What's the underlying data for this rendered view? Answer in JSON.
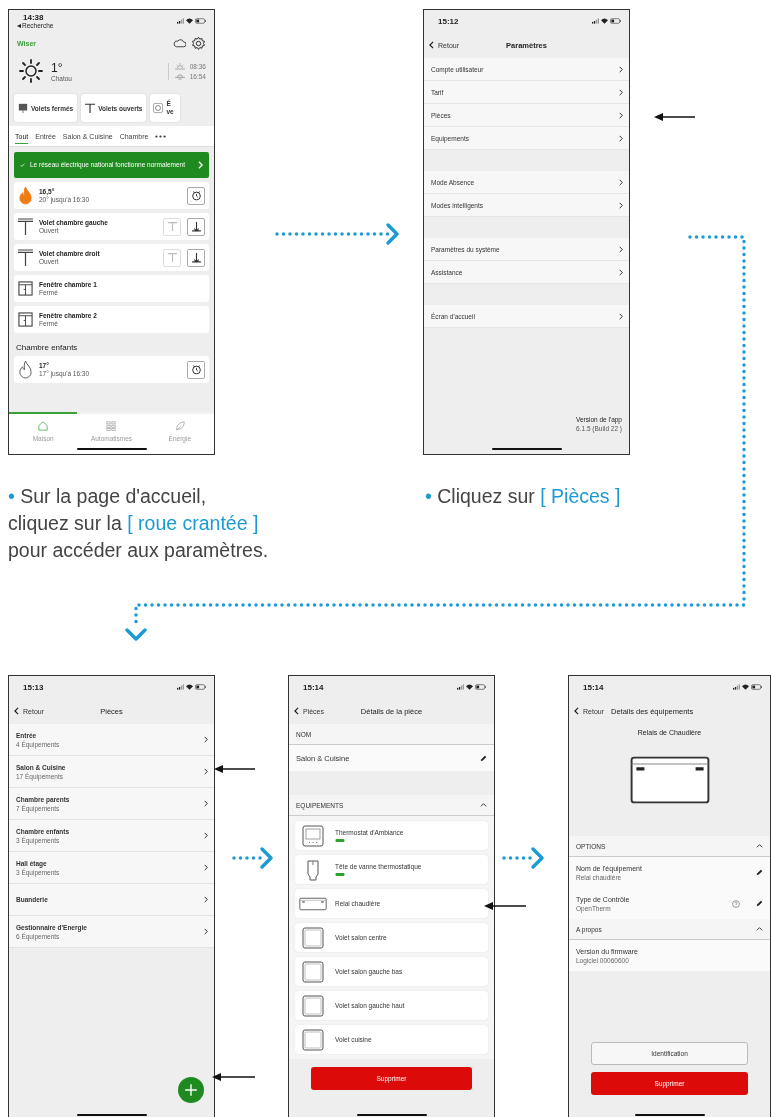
{
  "screens": [
    {
      "kind": "home",
      "time": "14:38",
      "back": "Recherche",
      "logo": "Wiser",
      "weather": {
        "temp": "1°",
        "city": "Chatou",
        "sunrise": "08:36",
        "sunset": "16:54"
      },
      "shortcuts": [
        {
          "kind": "closed",
          "label": "Volets fermés"
        },
        {
          "kind": "open",
          "label": "Volets ouverts"
        },
        {
          "kind": "timer",
          "label": "É ve"
        }
      ],
      "tabs": [
        {
          "label": "Tout",
          "selected": true
        },
        {
          "label": "Entrée",
          "selected": false
        },
        {
          "label": "Salon & Cuisine",
          "selected": false
        },
        {
          "label": "Chambre",
          "selected": false
        }
      ],
      "banner": "Le réseau électrique national fonctionne normalement",
      "items": [
        {
          "kind": "heating",
          "active": true,
          "title": "16,5°",
          "subtitle": "20° jusqu'à 16:30"
        },
        {
          "kind": "shutter",
          "title": "Volet chambre gauche",
          "subtitle": "Ouvert"
        },
        {
          "kind": "shutter",
          "title": "Volet chambre droit",
          "subtitle": "Ouvert"
        },
        {
          "kind": "window",
          "title": "Fenêtre chambre 1",
          "subtitle": "Fermé"
        },
        {
          "kind": "window",
          "title": "Fenêtre chambre 2",
          "subtitle": "Fermé"
        },
        {
          "kind": "section",
          "title": "Chambre enfants"
        },
        {
          "kind": "heating",
          "active": false,
          "title": "17°",
          "subtitle": "17° jusqu'à 16:30"
        }
      ],
      "nav": [
        {
          "kind": "home",
          "label": "Maison",
          "selected": true
        },
        {
          "kind": "automations",
          "label": "Automatismes",
          "selected": false
        },
        {
          "kind": "energy",
          "label": "Énergie",
          "selected": false
        }
      ]
    },
    {
      "kind": "settings",
      "time": "15:12",
      "back": "Retour",
      "title": "Paramètres",
      "groups": [
        [
          "Compte utilisateur",
          "Tarif",
          "Pièces",
          "Equipements"
        ],
        [
          "Mode Absence",
          "Modes intelligents"
        ],
        [
          "Paramètres du système",
          "Assistance"
        ],
        [
          "Écran d'accueil"
        ]
      ],
      "version_label": "Version de l'app",
      "version": "6.1.5 (Build 22 )"
    },
    {
      "kind": "rooms",
      "time": "15:13",
      "back": "Retour",
      "title": "Pièces",
      "rooms": [
        {
          "name": "Entrée",
          "count": "4 Équipements"
        },
        {
          "name": "Salon & Cuisine",
          "count": "17 Équipements"
        },
        {
          "name": "Chambre parents",
          "count": "7 Équipements"
        },
        {
          "name": "Chambre enfants",
          "count": "3 Équipements"
        },
        {
          "name": "Hall étage",
          "count": "3 Équipements"
        },
        {
          "name": "Buanderie"
        },
        {
          "name": "Gestionnaire d'Energie",
          "count": "6 Équipements"
        }
      ]
    },
    {
      "kind": "room_details",
      "time": "15:14",
      "back": "Pièces",
      "title": "Détails de la pièce",
      "name_header": "NOM",
      "name": "Salon & Cuisine",
      "devices_header": "EQUIPEMENTS",
      "devices_expanded": true,
      "devices": [
        {
          "kind": "thermostat",
          "name": "Thermostat d'Ambiance"
        },
        {
          "kind": "valve",
          "name": "Tête de vanne thermostatique"
        },
        {
          "kind": "relay",
          "name": "Relai chaudière"
        },
        {
          "kind": "shutter",
          "name": "Volet salon centre"
        },
        {
          "kind": "shutter",
          "name": "Volet salon gauche bas"
        },
        {
          "kind": "shutter",
          "name": "Volet salon gauche haut"
        },
        {
          "kind": "shutter",
          "name": "Volet cuisine"
        }
      ],
      "delete": "Supprimer"
    },
    {
      "kind": "device_details",
      "time": "15:14",
      "back": "Retour",
      "title": "Details des équipements",
      "device": "Relais de Chaudière",
      "sections": [
        {
          "title": "OPTIONS",
          "expanded": true,
          "rows": [
            {
              "label": "Nom de l'équipement",
              "value": "Relai chaudière",
              "help": false,
              "editable": true
            },
            {
              "label": "Type de Contrôle",
              "value": "OpenTherm",
              "help": true,
              "editable": true
            }
          ]
        },
        {
          "title": "A propos",
          "expanded": true,
          "rows": [
            {
              "label": "Version du firmware",
              "value": "Logiciel 00060600",
              "help": false,
              "editable": false
            }
          ]
        }
      ],
      "buttons": [
        {
          "kind": "secondary",
          "label": "Identification"
        },
        {
          "kind": "danger",
          "label": "Supprimer"
        }
      ]
    }
  ],
  "captions": [
    {
      "parts": [
        {
          "text": "•",
          "highlight": true
        },
        {
          "text": " Sur la page d'accueil,\ncliquez sur la ",
          "highlight": false
        },
        {
          "text": "[ roue crantée ]",
          "highlight": true
        },
        {
          "text": "\npour accéder aux paramètres.",
          "highlight": false
        }
      ]
    },
    {
      "parts": [
        {
          "text": "•",
          "highlight": true
        },
        {
          "text": " Cliquez sur ",
          "highlight": false
        },
        {
          "text": "[ Pièces ]",
          "highlight": true
        }
      ]
    }
  ]
}
